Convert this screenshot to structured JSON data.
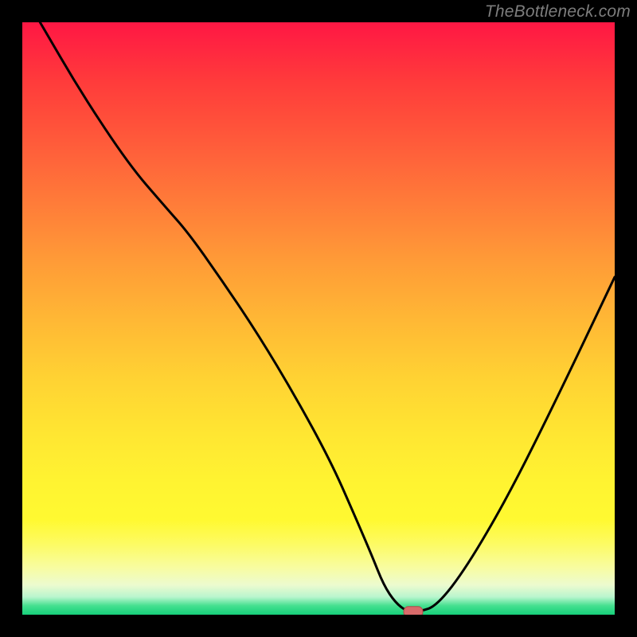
{
  "watermark": {
    "text": "TheBottleneck.com"
  },
  "chart_data": {
    "type": "line",
    "title": "",
    "xlabel": "",
    "ylabel": "",
    "xlim": [
      0,
      100
    ],
    "ylim": [
      0,
      100
    ],
    "grid": false,
    "legend": false,
    "background": "red-yellow-green vertical gradient",
    "series": [
      {
        "name": "bottleneck-curve",
        "color": "#000000",
        "x": [
          3,
          10,
          18,
          24,
          28,
          34,
          40,
          46,
          52,
          56,
          59,
          61,
          63,
          65,
          67,
          70,
          75,
          82,
          90,
          100
        ],
        "values": [
          100,
          88,
          76,
          69,
          64.5,
          56,
          47,
          37,
          26,
          17,
          10,
          5,
          2,
          0.5,
          0.5,
          1.5,
          8,
          20,
          36,
          57
        ]
      }
    ],
    "marker": {
      "name": "optimal-point",
      "x": 66,
      "y": 0.5,
      "color": "#d86a6a",
      "shape": "rounded-rect"
    }
  }
}
